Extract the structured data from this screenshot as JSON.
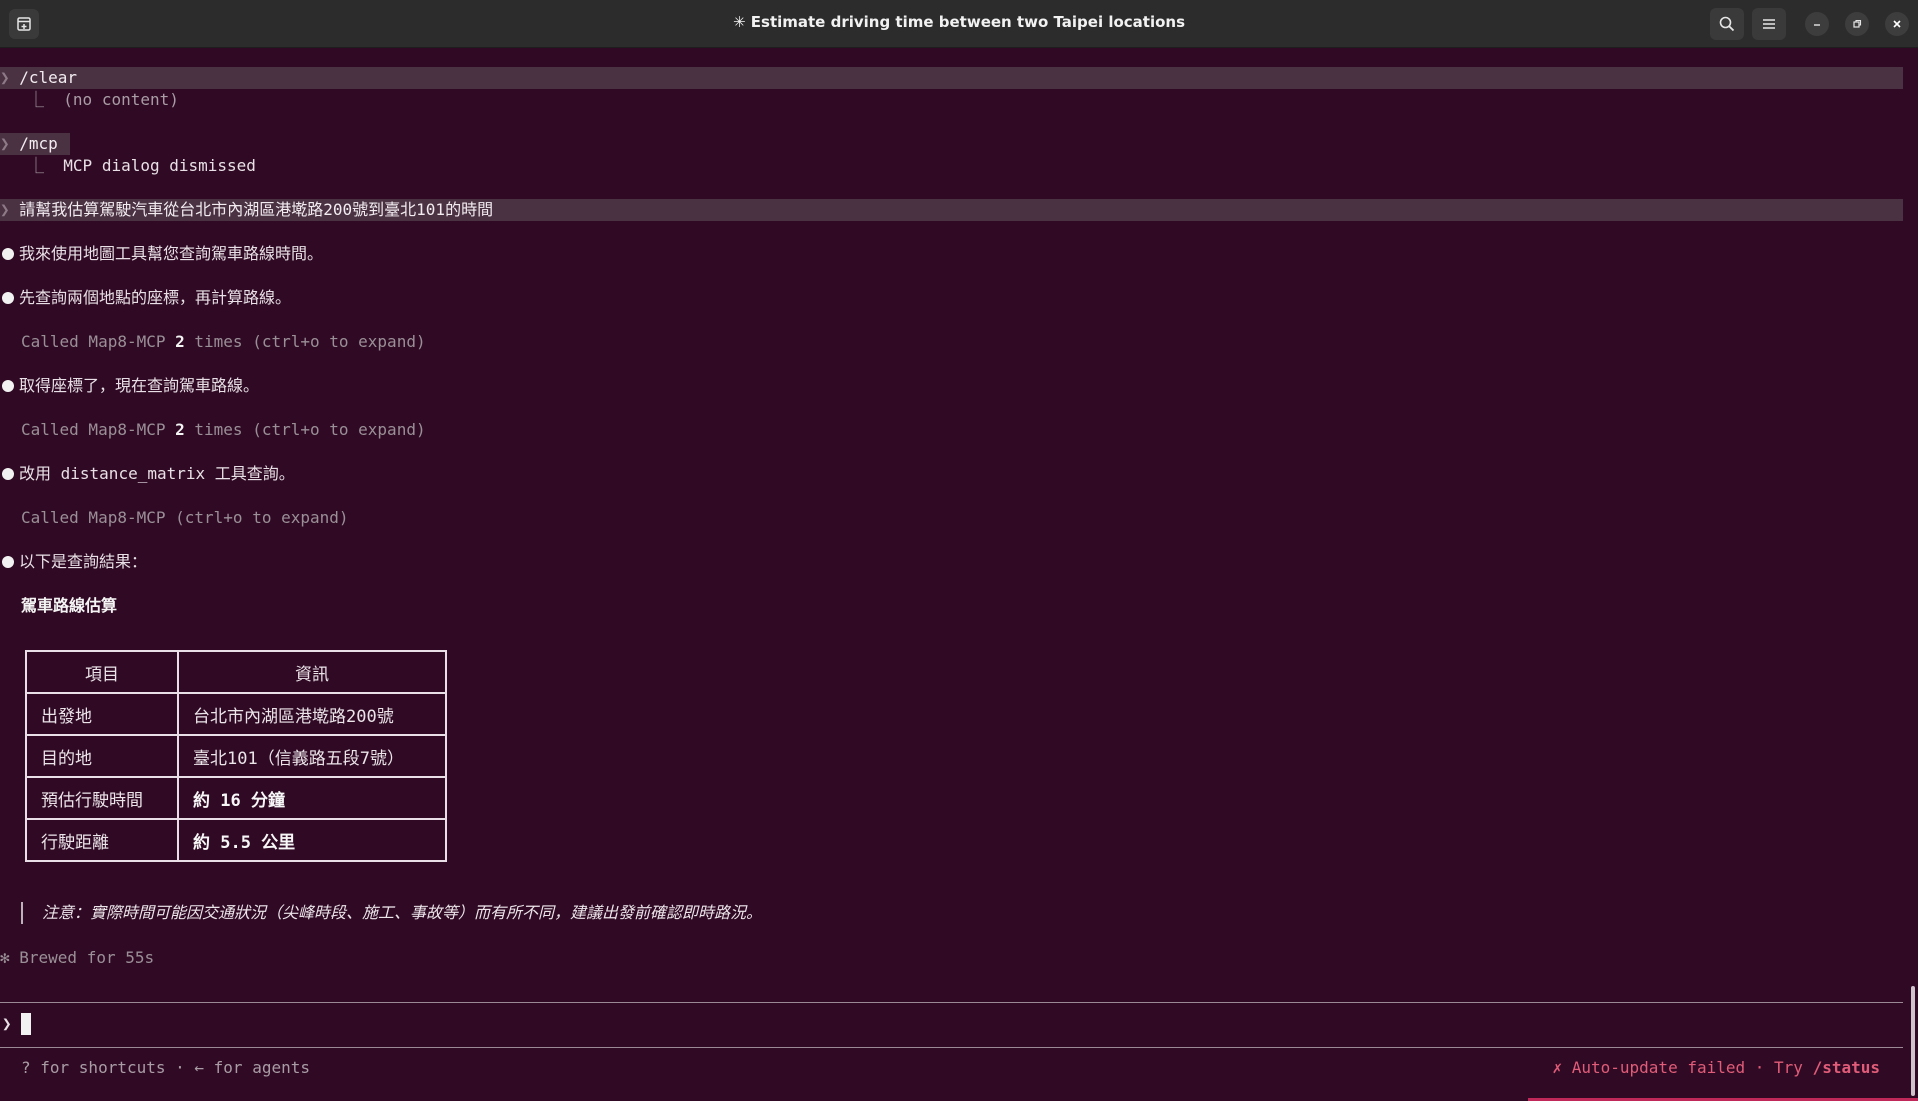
{
  "window": {
    "title": "✳ Estimate driving time between two Taipei locations"
  },
  "session": {
    "entries": [
      {
        "cmd": "/clear",
        "result": "(no content)"
      },
      {
        "cmd": "/mcp",
        "result": "MCP dialog dismissed"
      }
    ],
    "user_prompt": "請幫我估算駕駛汽車從台北市內湖區港墘路200號到臺北101的時間"
  },
  "conversation": {
    "msg1": "我來使用地圖工具幫您查詢駕車路線時間。",
    "msg2": "先查詢兩個地點的座標，再計算路線。",
    "tool1": {
      "prefix": "Called Map8-MCP ",
      "count": "2",
      "suffix": " times (ctrl+o to expand)"
    },
    "msg3": "取得座標了，現在查詢駕車路線。",
    "tool2": {
      "prefix": "Called Map8-MCP ",
      "count": "2",
      "suffix": " times (ctrl+o to expand)"
    },
    "msg4_pre": "改用 ",
    "msg4_code": "distance_matrix",
    "msg4_post": " 工具查詢。",
    "tool3": "Called Map8-MCP (ctrl+o to expand)",
    "msg5": "以下是查詢結果："
  },
  "result": {
    "heading": "駕車路線估算",
    "headers": [
      "項目",
      "資訊"
    ],
    "rows": [
      {
        "item": "出發地",
        "info": "台北市內湖區港墘路200號"
      },
      {
        "item": "目的地",
        "info": "臺北101（信義路五段7號）"
      },
      {
        "item": "預估行駛時間",
        "info": "約 16 分鐘"
      },
      {
        "item": "行駛距離",
        "info": "約 5.5 公里"
      }
    ],
    "note": "注意：實際時間可能因交通狀況（尖峰時段、施工、事故等）而有所不同，建議出發前確認即時路況。"
  },
  "status": {
    "brewed": "Brewed for 55s"
  },
  "footer": {
    "left": "? for shortcuts · ← for agents",
    "right_prefix": "✗ Auto-update failed · Try ",
    "right_cmd": "/status"
  },
  "colors": {
    "background": "#300a24",
    "error": "#e05c78",
    "titlebar": "#2c2c2c"
  },
  "icons": [
    "new-tab-icon",
    "search-icon",
    "menu-icon",
    "minimize-icon",
    "restore-icon",
    "close-icon",
    "tree-branch-icon",
    "prompt-chevron-icon",
    "sparkle-icon"
  ]
}
